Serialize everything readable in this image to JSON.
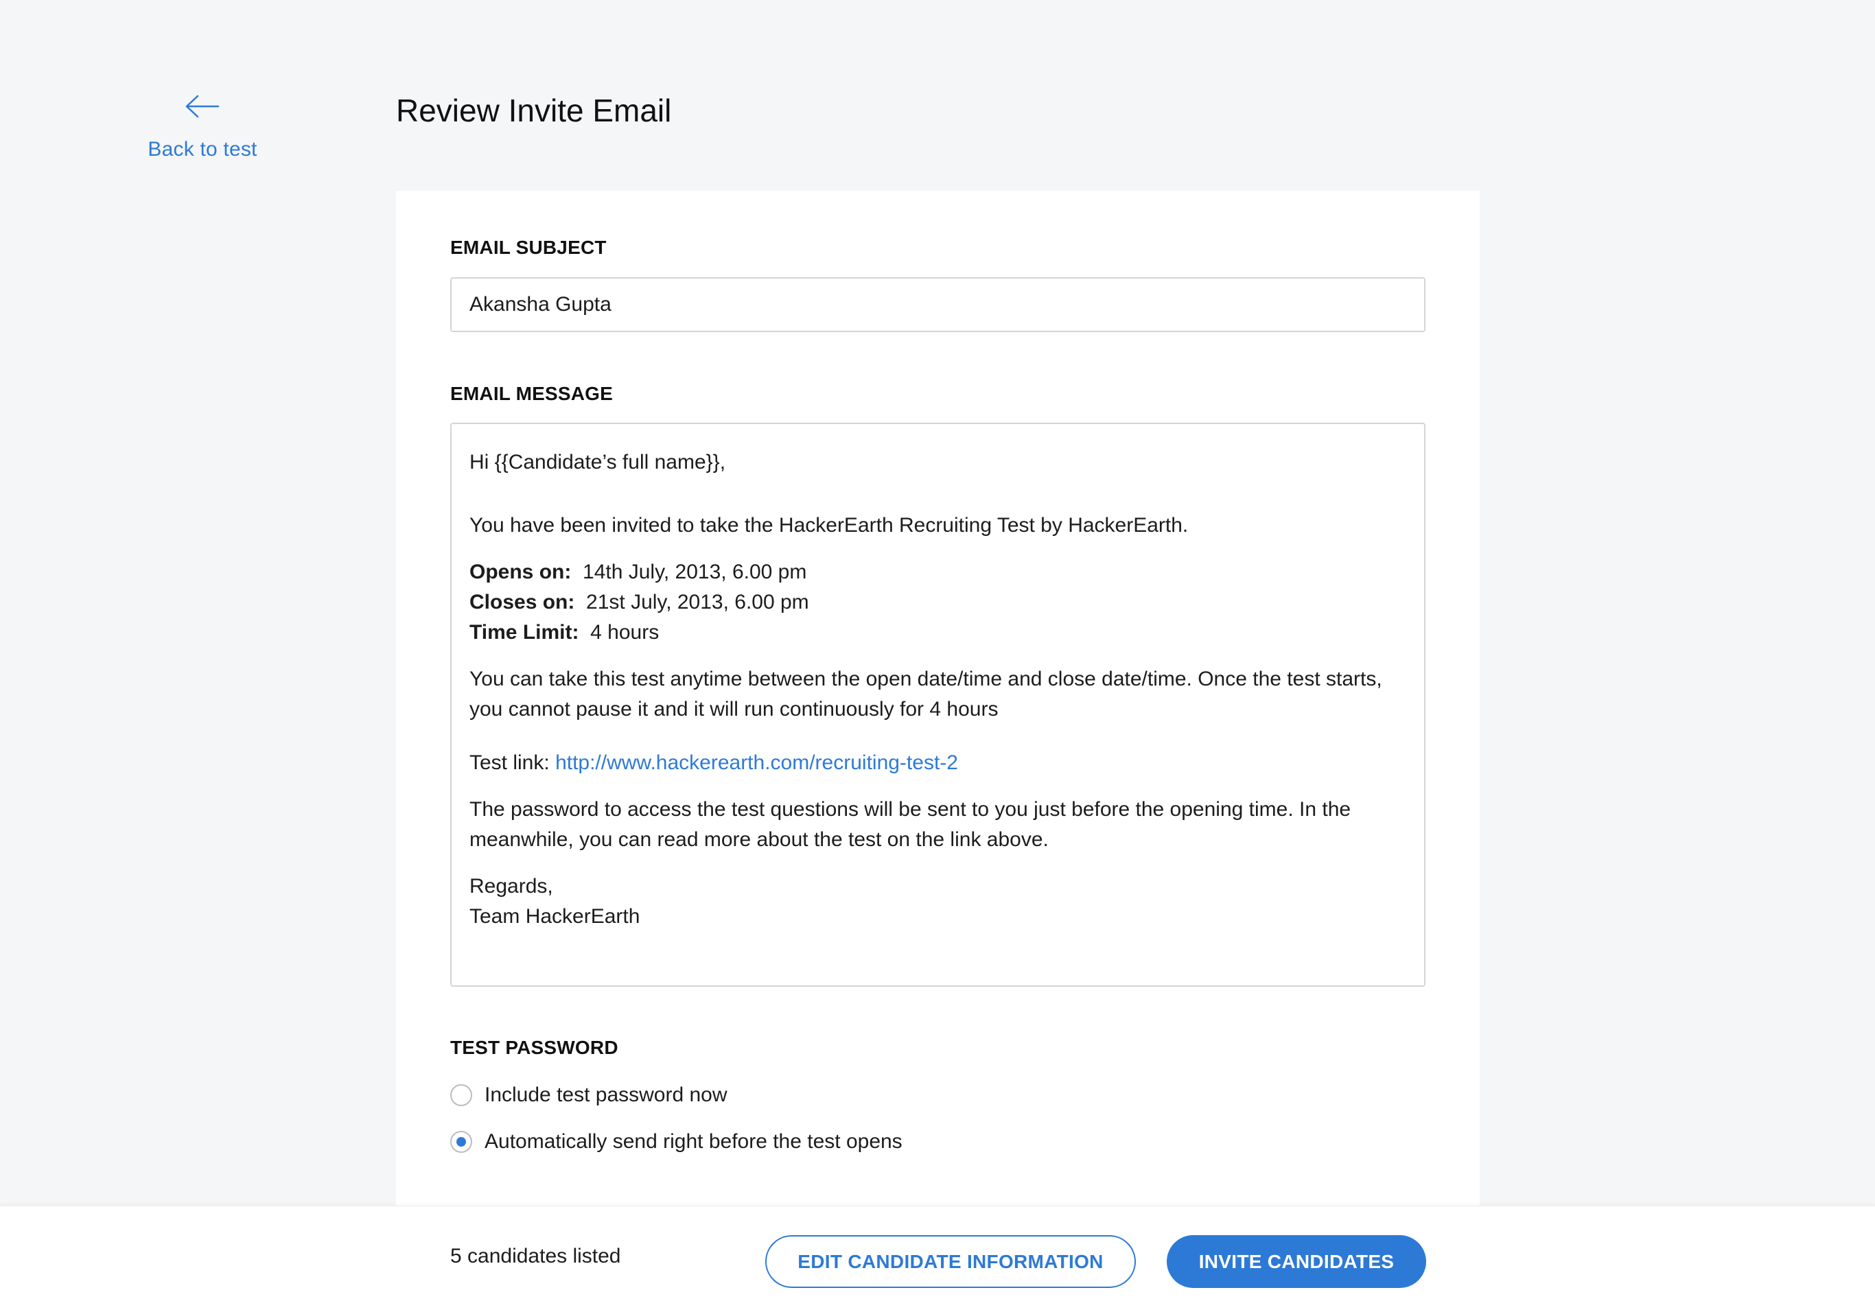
{
  "nav": {
    "back_label": "Back to test"
  },
  "header": {
    "title": "Review Invite Email"
  },
  "form": {
    "subject_label": "EMAIL SUBJECT",
    "subject_value": "Akansha Gupta",
    "message_label": "EMAIL MESSAGE",
    "message": {
      "greeting": "Hi {{Candidate’s full name}},",
      "intro": "You have been invited to take the HackerEarth Recruiting Test by HackerEarth.",
      "opens_label": "Opens on:",
      "opens_value": "14th July, 2013,  6.00 pm",
      "closes_label": "Closes on:",
      "closes_value": "21st July, 2013,  6.00 pm",
      "limit_label": "Time Limit:",
      "limit_value": "4 hours",
      "body_1": "You can take this test anytime between the open date/time and close date/time. Once the test starts, you cannot pause it and it will run continuously for 4 hours",
      "test_link_prefix": "Test link:",
      "test_link": "http://www.hackerearth.com/recruiting-test-2",
      "body_2": "The password to access the test questions will be sent to you just before the opening time. In the meanwhile, you can read more about the test on the link above.",
      "regards": "Regards,",
      "signature": "Team HackerEarth"
    },
    "password_label": "TEST PASSWORD",
    "password_options": [
      {
        "label": "Include test password now",
        "selected": false
      },
      {
        "label": "Automatically send right before the test opens",
        "selected": true
      }
    ]
  },
  "footer": {
    "count_text": "5 candidates listed",
    "edit_button": "EDIT CANDIDATE INFORMATION",
    "invite_button": "INVITE CANDIDATES"
  },
  "colors": {
    "accent": "#2d7ad6",
    "background": "#f5f6f8",
    "card": "#ffffff",
    "border": "#d3d5d9"
  },
  "icons": {
    "back": "arrow-left-icon"
  }
}
